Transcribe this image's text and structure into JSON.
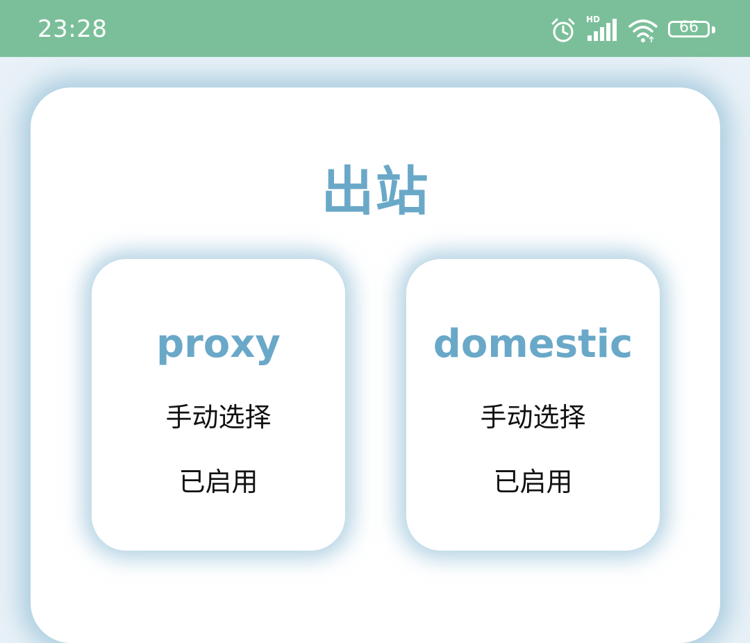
{
  "status_bar": {
    "time": "23:28",
    "battery": "66",
    "network_label": "HD",
    "icons": [
      "alarm-icon",
      "signal-icon",
      "wifi-icon",
      "battery-icon"
    ],
    "background_color": "#7bbf9a"
  },
  "panel": {
    "title": "出站",
    "accent_color": "#6aa8c8",
    "cards": [
      {
        "name": "proxy",
        "mode": "手动选择",
        "status": "已启用"
      },
      {
        "name": "domestic",
        "mode": "手动选择",
        "status": "已启用"
      }
    ]
  }
}
